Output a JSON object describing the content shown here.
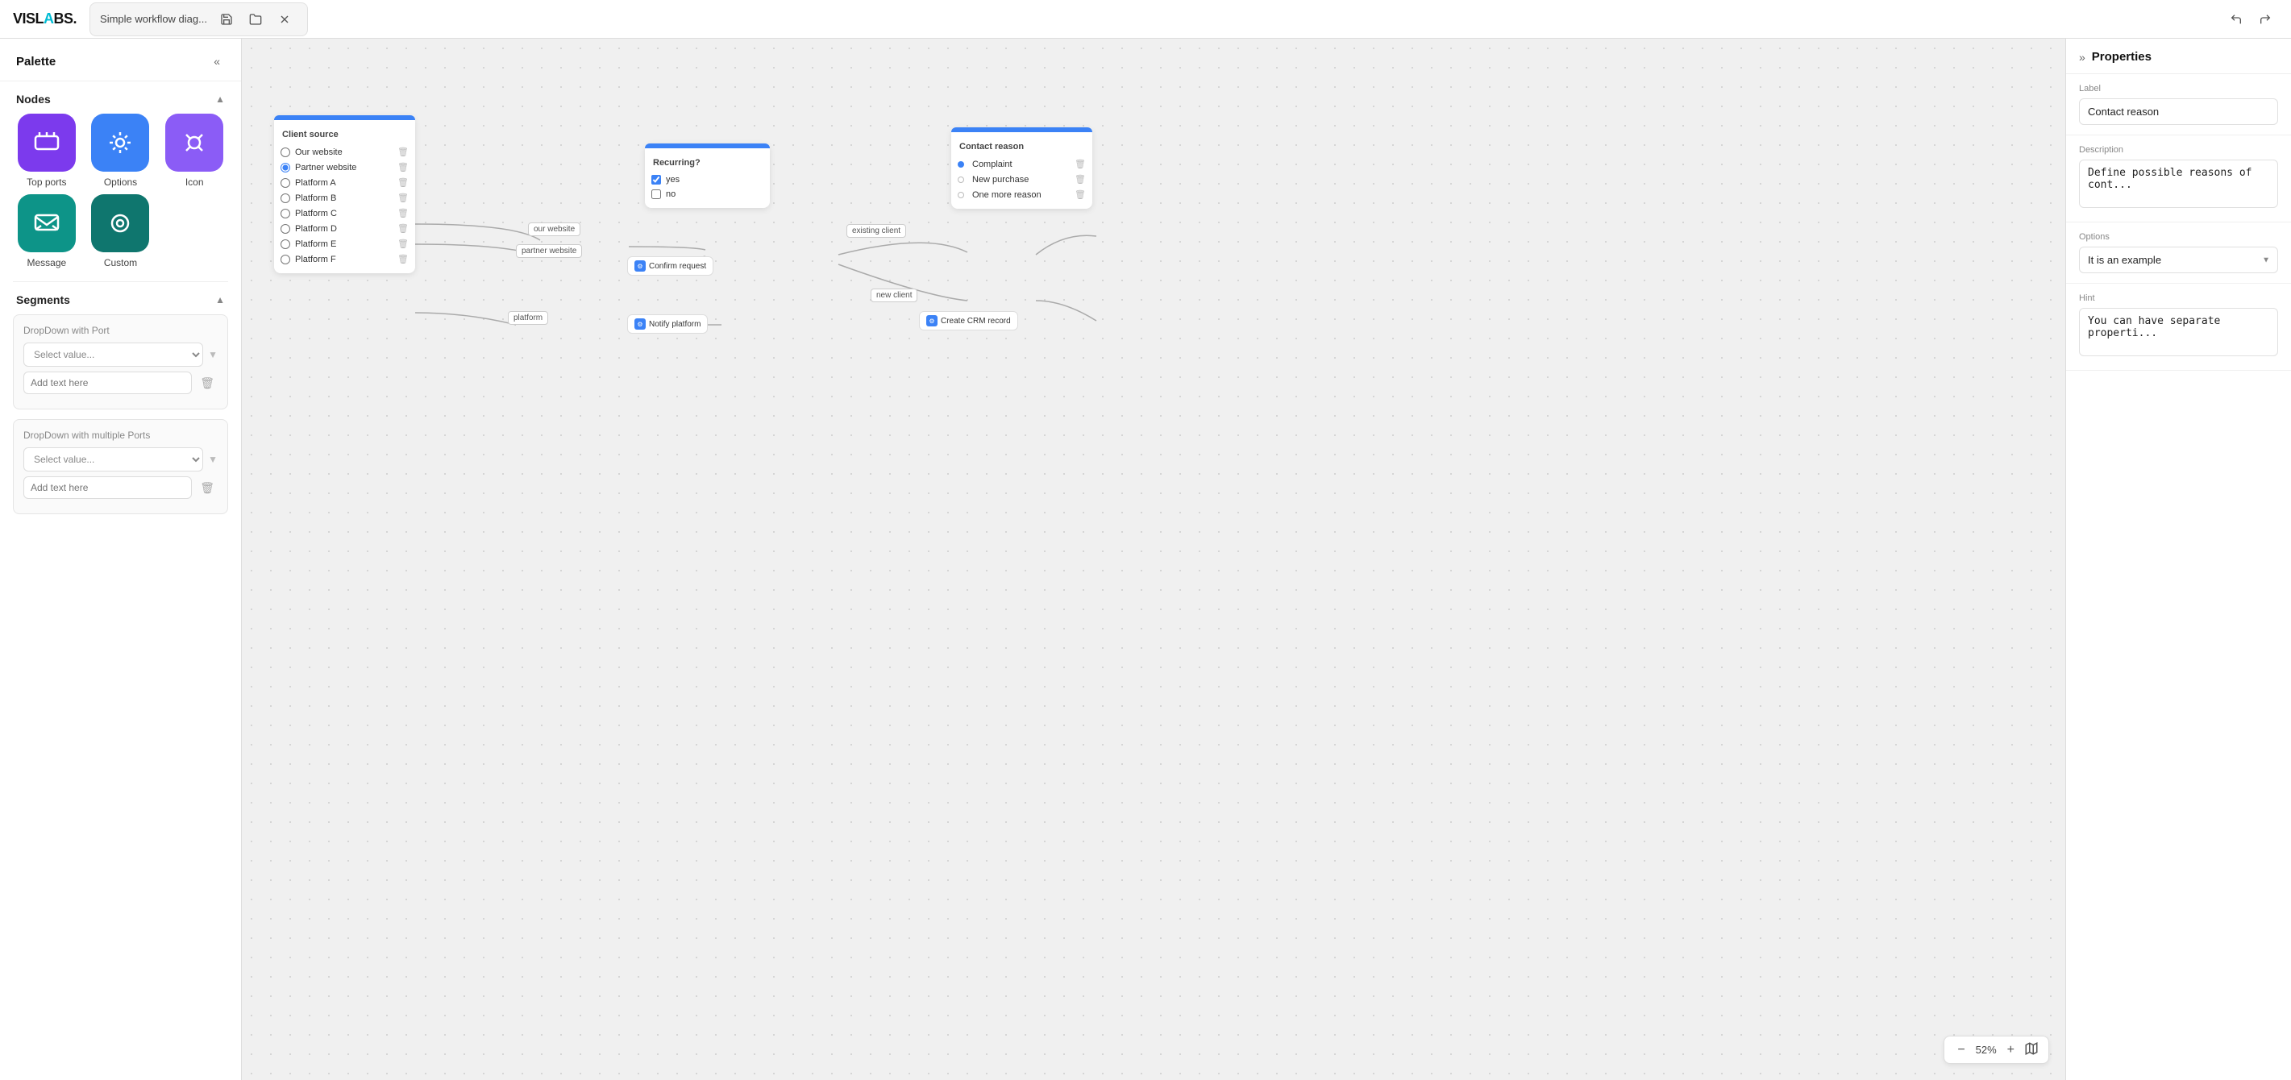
{
  "topbar": {
    "logo_text": "VISLABS.",
    "logo_accent": "◆",
    "title": "Simple workflow diag...",
    "save_label": "💾",
    "open_label": "📂",
    "settings_label": "✕",
    "undo_label": "↩",
    "redo_label": "↪"
  },
  "palette": {
    "title": "Palette",
    "collapse_label": "«",
    "nodes_section": "Nodes",
    "nodes": [
      {
        "id": "top-ports",
        "label": "Top ports",
        "icon": "⊞",
        "style": "purple"
      },
      {
        "id": "options",
        "label": "Options",
        "icon": "⚙",
        "style": "blue"
      },
      {
        "id": "icon",
        "label": "Icon",
        "icon": "⚙",
        "style": "violet"
      },
      {
        "id": "message",
        "label": "Message",
        "icon": "✉",
        "style": "teal"
      },
      {
        "id": "custom",
        "label": "Custom",
        "icon": "◎",
        "style": "teal2"
      }
    ],
    "segments_section": "Segments",
    "dropdown_with_port_label": "DropDown with Port",
    "select_placeholder": "Select value...",
    "add_text_placeholder": "Add text here",
    "dropdown_multiple_label": "DropDown with multiple Ports",
    "select_placeholder2": "Select value...",
    "add_text_placeholder2": "Add text here"
  },
  "canvas": {
    "zoom_level": "52%",
    "client_source": {
      "title": "Client source",
      "options": [
        "Our website",
        "Partner website",
        "Platform A",
        "Platform B",
        "Platform C",
        "Platform D",
        "Platform E",
        "Platform F"
      ]
    },
    "recurring": {
      "title": "Recurring?",
      "options": [
        {
          "label": "yes",
          "checked": true
        },
        {
          "label": "no",
          "checked": false
        }
      ]
    },
    "contact_reason": {
      "title": "Contact reason",
      "options": [
        {
          "label": "Complaint",
          "selected": true
        },
        {
          "label": "New purchase",
          "selected": false
        },
        {
          "label": "One more reason",
          "selected": false
        }
      ]
    },
    "edge_labels": [
      "our website",
      "partner website",
      "platform",
      "existing client",
      "new client"
    ],
    "action_nodes": [
      "Confirm request",
      "Notify platform",
      "Create CRM record"
    ]
  },
  "properties": {
    "title": "Properties",
    "expand_label": "»",
    "label_field": {
      "label": "Label",
      "value": "Contact reason"
    },
    "description_field": {
      "label": "Description",
      "value": "Define possible reasons of cont..."
    },
    "options_field": {
      "label": "Options",
      "value": "It is an example"
    },
    "hint_field": {
      "label": "Hint",
      "value": "You can have separate properti..."
    }
  }
}
